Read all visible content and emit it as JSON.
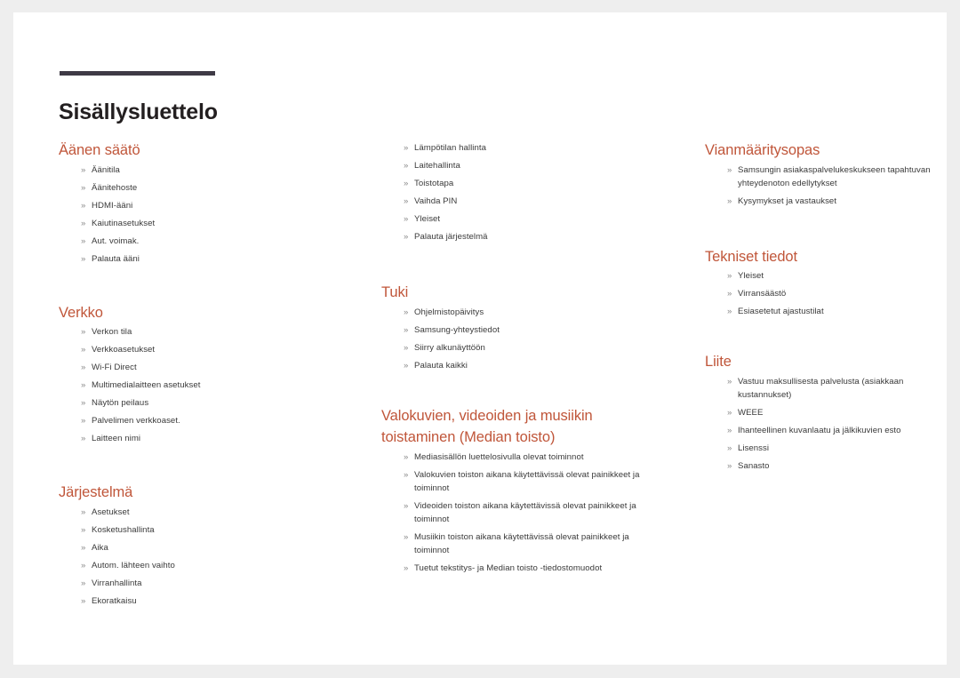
{
  "document": {
    "title": "Sisällysluettelo",
    "bullet_marker": "»",
    "heading_color": "#c0563a",
    "rule_color": "#3e3a45",
    "body_color": "#3a3a3a"
  },
  "columns": [
    {
      "id": "column-left",
      "sections": [
        {
          "heading": "Äänen säätö",
          "items": [
            "Äänitila",
            "Äänitehoste",
            "HDMI-ääni",
            "Kaiutinasetukset",
            "Aut. voimak.",
            "Palauta ääni"
          ]
        },
        {
          "heading": "Verkko",
          "items": [
            "Verkon tila",
            "Verkkoasetukset",
            "Wi-Fi Direct",
            "Multimedialaitteen asetukset",
            "Näytön peilaus",
            "Palvelimen verkkoaset.",
            "Laitteen nimi"
          ]
        },
        {
          "heading": "Järjestelmä",
          "items": [
            "Asetukset",
            "Kosketushallinta",
            "Aika",
            "Autom. lähteen vaihto",
            "Virranhallinta",
            "Ekoratkaisu"
          ]
        }
      ]
    },
    {
      "id": "column-middle",
      "sections": [
        {
          "heading": "",
          "items": [
            "Lämpötilan hallinta",
            "Laitehallinta",
            "Toistotapa",
            "Vaihda PIN",
            "Yleiset",
            "Palauta järjestelmä"
          ]
        },
        {
          "heading": "Tuki",
          "items": [
            "Ohjelmistopäivitys",
            "Samsung-yhteystiedot",
            "Siirry alkunäyttöön",
            "Palauta kaikki"
          ]
        },
        {
          "heading": "Valokuvien, videoiden ja musiikin toistaminen (Median toisto)",
          "items": [
            "Mediasisällön luettelosivulla olevat toiminnot",
            "Valokuvien toiston aikana käytettävissä olevat painikkeet ja toiminnot",
            "Videoiden toiston aikana käytettävissä olevat painikkeet ja toiminnot",
            "Musiikin toiston aikana käytettävissä olevat painikkeet ja toiminnot",
            "Tuetut tekstitys- ja Median toisto -tiedostomuodot"
          ]
        }
      ]
    },
    {
      "id": "column-right",
      "sections": [
        {
          "heading": "Vianmääritysopas",
          "items": [
            "Samsungin asiakaspalvelukeskukseen tapahtuvan yhteydenoton edellytykset",
            "Kysymykset ja vastaukset"
          ]
        },
        {
          "heading": "Tekniset tiedot",
          "items": [
            "Yleiset",
            "Virransäästö",
            "Esiasetetut ajastustilat"
          ]
        },
        {
          "heading": "Liite",
          "items": [
            "Vastuu maksullisesta palvelusta (asiakkaan kustannukset)",
            "WEEE",
            "Ihanteellinen kuvanlaatu ja jälkikuvien esto",
            "Lisenssi",
            "Sanasto"
          ]
        }
      ]
    }
  ]
}
